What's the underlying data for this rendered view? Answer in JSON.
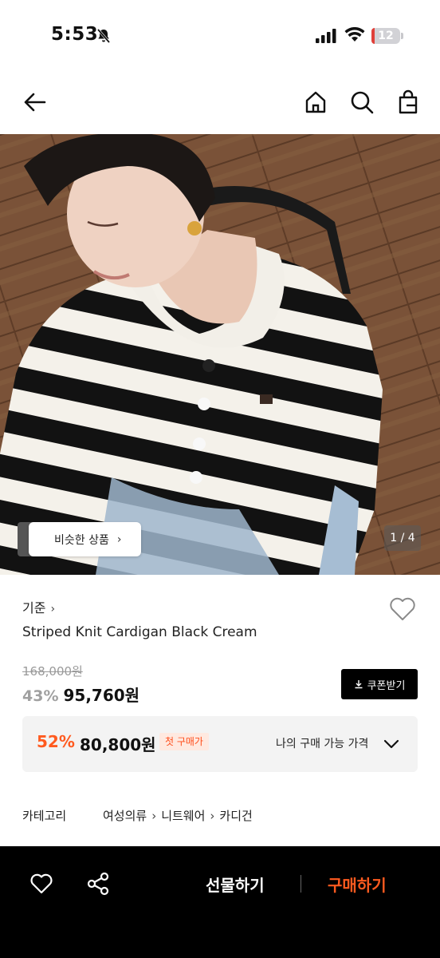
{
  "status_bar": {
    "time": "5:53",
    "battery": "12",
    "battery_level": 0.12,
    "icons": [
      "bell-slash-icon",
      "cellular-signal-icon",
      "wifi-icon",
      "battery-icon"
    ]
  },
  "header": {
    "icons": [
      "back-arrow-icon",
      "home-icon",
      "search-icon",
      "shopping-bag-icon"
    ]
  },
  "gallery": {
    "similar_label": "비슷한 상품",
    "counter": "1 / 4"
  },
  "product": {
    "brand": "기준",
    "name": "Striped Knit Cardigan Black Cream",
    "original_price": "168,000원",
    "discount": "43%",
    "price": "95,760원",
    "coupon_label": "쿠폰받기"
  },
  "best_price": {
    "discount": "52%",
    "price": "80,800원",
    "badge": "첫 구매가",
    "label": "나의 구매 가능 가격"
  },
  "category": {
    "label": "카테고리",
    "path": [
      "여성의류",
      "니트웨어",
      "카디건"
    ]
  },
  "bottom_bar": {
    "gift_label": "선물하기",
    "buy_label": "구매하기"
  },
  "colors": {
    "accent": "#ff5a1f",
    "bottom_bar": "#000000"
  }
}
